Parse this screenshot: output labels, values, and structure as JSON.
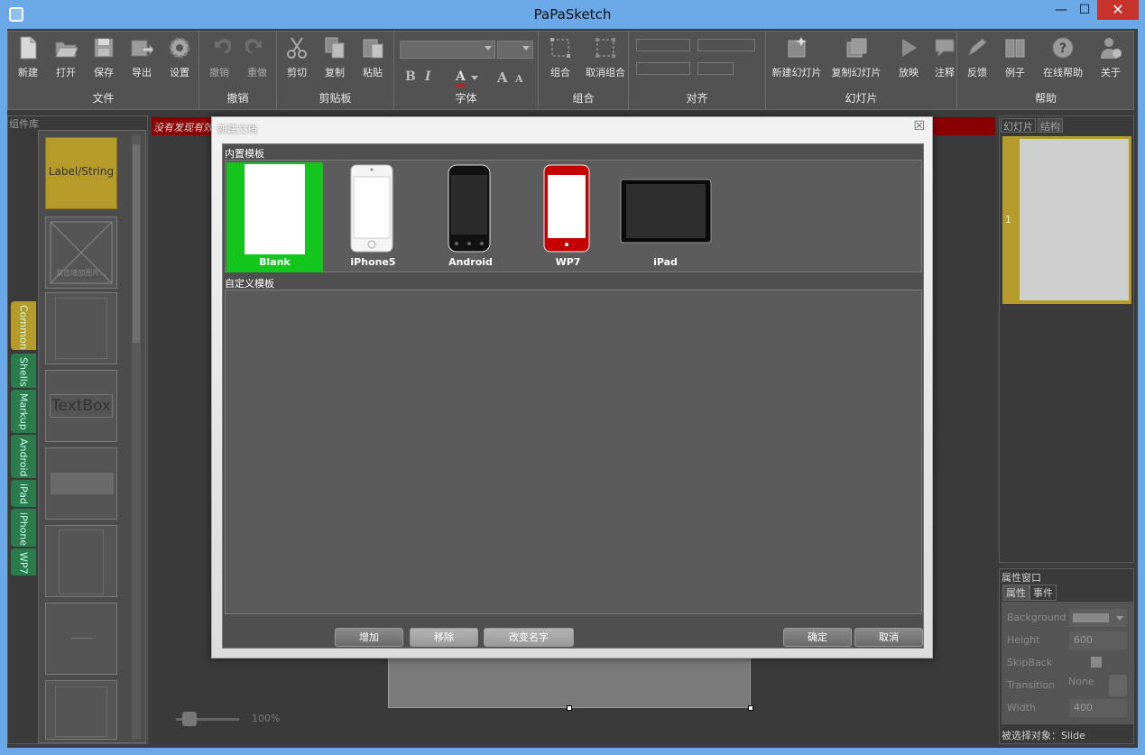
{
  "window": {
    "title": "PaPaSketch",
    "minimize": "—",
    "maximize": "☐",
    "close": "✕"
  },
  "ribbon": {
    "file": {
      "title": "文件",
      "new": "新建",
      "open": "打开",
      "save": "保存",
      "export": "导出",
      "settings": "设置"
    },
    "undo_group": {
      "title": "撤销",
      "undo": "撤销",
      "redo": "重做"
    },
    "clipboard": {
      "title": "剪贴板",
      "cut": "剪切",
      "copy": "复制",
      "paste": "粘贴"
    },
    "font": {
      "title": "字体",
      "bold": "B",
      "italic": "I",
      "color": "A",
      "grow": "A",
      "shrink": "A"
    },
    "group": {
      "title": "组合",
      "group": "组合",
      "ungroup": "取消组合"
    },
    "align": {
      "title": "对齐"
    },
    "slides": {
      "title": "幻灯片",
      "new_slide": "新建幻灯片",
      "copy_slide": "复制幻灯片",
      "play": "放映",
      "annotate": "注释"
    },
    "help": {
      "title": "帮助",
      "feedback": "反馈",
      "examples": "例子",
      "online_help": "在线帮助",
      "about": "关于"
    }
  },
  "library": {
    "header": "组件库",
    "items": [
      {
        "label": "Label/String"
      },
      {
        "label": "双击增加图片..."
      },
      {
        "label": ""
      },
      {
        "label": "TextBox"
      },
      {
        "label": ""
      },
      {
        "label": ""
      },
      {
        "label": ""
      },
      {
        "label": ""
      }
    ],
    "tabs": [
      "Common",
      "Shells",
      "Markup",
      "Android",
      "iPad",
      "iPhone",
      "WP7"
    ]
  },
  "canvas": {
    "warning": "没有发现有效",
    "zoom": "100%"
  },
  "slides_panel": {
    "tab_slides": "幻灯片",
    "tab_structure": "结构",
    "slide_number": "1"
  },
  "properties": {
    "header": "属性窗口",
    "tab_props": "属性",
    "tab_events": "事件",
    "rows": [
      {
        "name": "Background",
        "value": ""
      },
      {
        "name": "Height",
        "value": "600"
      },
      {
        "name": "SkipBack",
        "value": ""
      },
      {
        "name": "Transition",
        "value": "None"
      },
      {
        "name": "Width",
        "value": "400"
      }
    ],
    "selected": "被选择对象：Slide"
  },
  "dialog": {
    "title": "新建文档",
    "builtin_label": "内置模板",
    "custom_label": "自定义模板",
    "templates": [
      {
        "name": "Blank",
        "selected": true
      },
      {
        "name": "iPhone5",
        "selected": false
      },
      {
        "name": "Android",
        "selected": false
      },
      {
        "name": "WP7",
        "selected": false
      },
      {
        "name": "iPad",
        "selected": false
      }
    ],
    "buttons": {
      "add": "增加",
      "remove": "移除",
      "rename": "改变名字",
      "ok": "确定",
      "cancel": "取消"
    }
  },
  "colors": {
    "accent_green": "#13c51c",
    "library_active": "#b59b2a",
    "warning_red": "#8a0000",
    "titlebar_blue": "#6aa8e8"
  }
}
